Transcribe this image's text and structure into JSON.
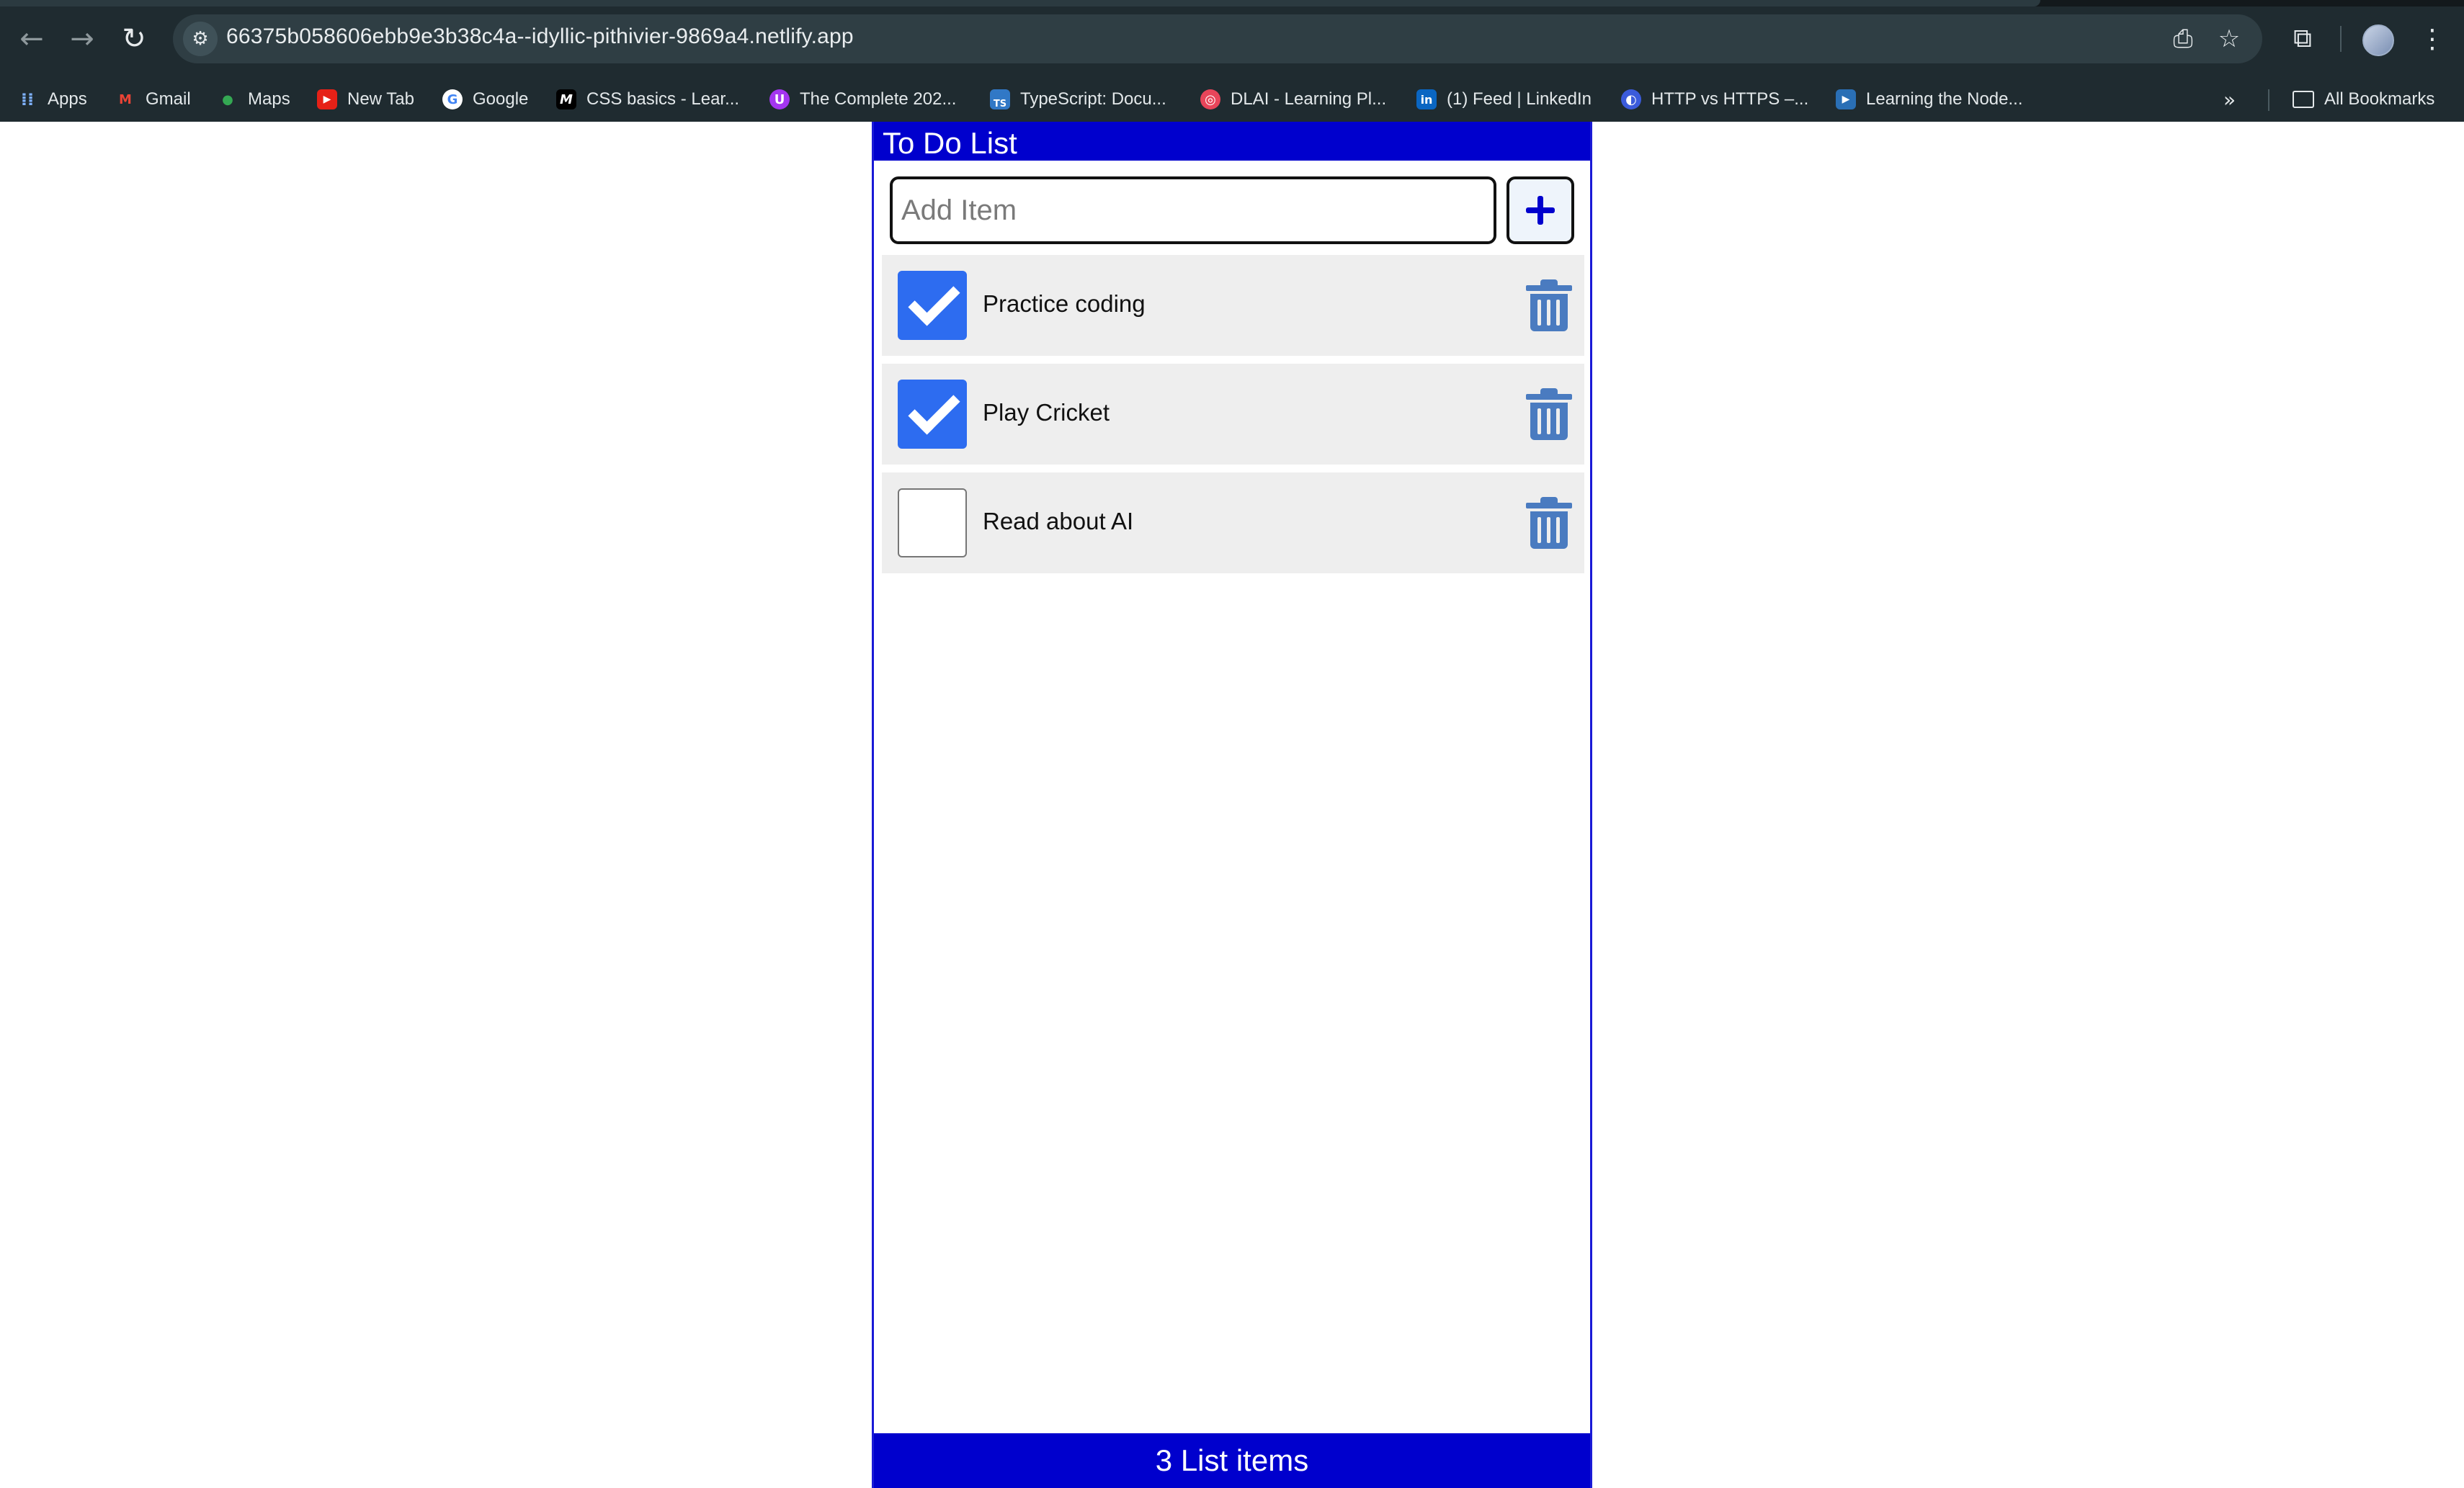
{
  "browser": {
    "url": "66375b058606ebb9e3b38c4a--idyllic-pithivier-9869a4.netlify.app",
    "icons": {
      "back": "arrow-left-icon",
      "forward": "arrow-right-icon",
      "reload": "reload-icon",
      "site_info": "tune-icon",
      "install": "install-icon",
      "star": "star-icon",
      "extensions": "puzzle-icon",
      "menu": "kebab-menu-icon",
      "more_bookmarks": "chevron-double-right-icon"
    },
    "bookmarks": [
      {
        "label": "Apps",
        "icon": "apps-grid-icon"
      },
      {
        "label": "Gmail",
        "icon": "gmail-icon"
      },
      {
        "label": "Maps",
        "icon": "maps-pin-icon"
      },
      {
        "label": "New Tab",
        "icon": "youtube-icon"
      },
      {
        "label": "Google",
        "icon": "google-icon"
      },
      {
        "label": "CSS basics - Lear...",
        "icon": "mdn-icon"
      },
      {
        "label": "The Complete 202...",
        "icon": "udemy-icon"
      },
      {
        "label": "TypeScript: Docu...",
        "icon": "typescript-icon"
      },
      {
        "label": "DLAI - Learning Pl...",
        "icon": "dlai-icon"
      },
      {
        "label": "(1) Feed | LinkedIn",
        "icon": "linkedin-icon"
      },
      {
        "label": "HTTP vs HTTPS –...",
        "icon": "globe-icon"
      },
      {
        "label": "Learning the Node...",
        "icon": "video-icon"
      }
    ],
    "all_bookmarks": "All Bookmarks"
  },
  "app": {
    "title": "To Do List",
    "add_placeholder": "Add Item",
    "add_value": "",
    "add_button_icon": "plus-icon",
    "items": [
      {
        "label": "Practice coding",
        "checked": true
      },
      {
        "label": "Play Cricket",
        "checked": true
      },
      {
        "label": "Read about AI",
        "checked": false
      }
    ],
    "footer": "3 List items",
    "colors": {
      "header": "#0000cd",
      "checked": "#2d6cf0",
      "trash": "#4a7bc0",
      "item_bg": "#eeeeee"
    }
  }
}
